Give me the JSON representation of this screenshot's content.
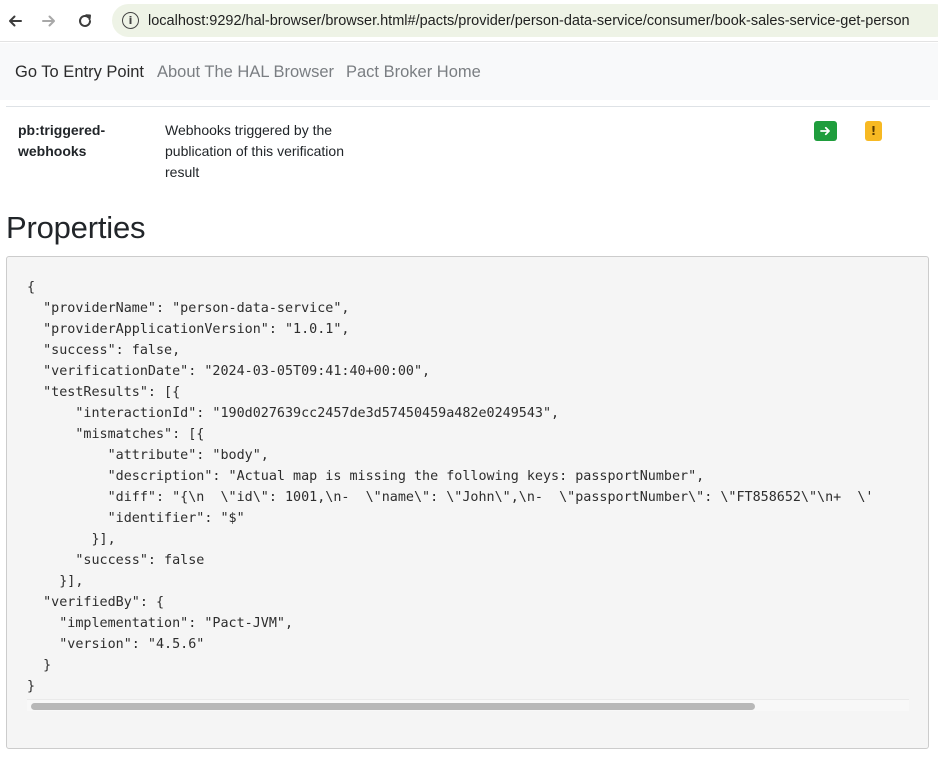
{
  "browser": {
    "url": "localhost:9292/hal-browser/browser.html#/pacts/provider/person-data-service/consumer/book-sales-service-get-person",
    "icons": {
      "back": "arrow-left-icon",
      "forward": "arrow-right-icon",
      "reload": "reload-icon",
      "site_info": "info-icon"
    }
  },
  "navbar": {
    "items": [
      {
        "label": "Go To Entry Point"
      },
      {
        "label": "About The HAL Browser"
      },
      {
        "label": "Pact Broker Home"
      }
    ]
  },
  "links": {
    "rows": [
      {
        "rel": "pb:triggered-webhooks",
        "rel_line1": "pb:triggered-",
        "rel_line2": "webhooks",
        "title_line1": "Webhooks triggered by the",
        "title_line2": "publication of this verification",
        "title_line3": "result",
        "follow_icon": "arrow-right-icon",
        "non_get_icon": "exclamation-icon",
        "non_get_label": "!"
      }
    ]
  },
  "properties": {
    "heading": "Properties",
    "json_text": "{\n  \"providerName\": \"person-data-service\",\n  \"providerApplicationVersion\": \"1.0.1\",\n  \"success\": false,\n  \"verificationDate\": \"2024-03-05T09:41:40+00:00\",\n  \"testResults\": [{\n      \"interactionId\": \"190d027639cc2457de3d57450459a482e0249543\",\n      \"mismatches\": [{\n          \"attribute\": \"body\",\n          \"description\": \"Actual map is missing the following keys: passportNumber\",\n          \"diff\": \"{\\n  \\\"id\\\": 1001,\\n-  \\\"name\\\": \\\"John\\\",\\n-  \\\"passportNumber\\\": \\\"FT858652\\\"\\n+  \\'\n          \"identifier\": \"$\"\n        }],\n      \"success\": false\n    }],\n  \"verifiedBy\": {\n    \"implementation\": \"Pact-JVM\",\n    \"version\": \"4.5.6\"\n  }\n}",
    "scroll_fraction_visible": 0.82
  },
  "colors": {
    "follow_button": "#1f9d3d",
    "non_get_button": "#f7b923",
    "navbar_bg": "#f8f9fa",
    "url_bar_bg": "#eef3e6"
  }
}
